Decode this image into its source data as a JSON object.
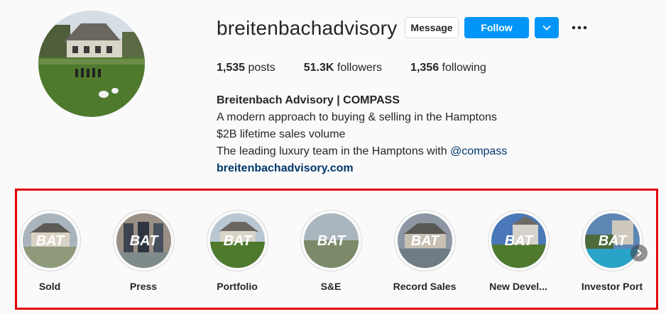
{
  "profile": {
    "username": "breitenbachadvisory",
    "avatar_icon": "profile-photo"
  },
  "actions": {
    "message_label": "Message",
    "follow_label": "Follow",
    "dropdown_icon": "chevron-down-icon",
    "more_icon": "more-options-icon"
  },
  "stats": {
    "posts_count": "1,535",
    "posts_label": "posts",
    "followers_count": "51.3K",
    "followers_label": "followers",
    "following_count": "1,356",
    "following_label": "following"
  },
  "bio": {
    "name": "Breitenbach Advisory | COMPASS",
    "line1": "A modern approach to buying & selling in the Hamptons",
    "line2": "$2B lifetime sales volume",
    "line3_prefix": "The leading luxury team in the Hamptons with ",
    "line3_mention": "@compass",
    "website": "breitenbachadvisory.com"
  },
  "highlights": {
    "cover_text": "BAT",
    "items": [
      {
        "label": "Sold"
      },
      {
        "label": "Press"
      },
      {
        "label": "Portfolio"
      },
      {
        "label": "S&E"
      },
      {
        "label": "Record Sales"
      },
      {
        "label": "New Devel..."
      },
      {
        "label": "Investor Port"
      }
    ],
    "next_icon": "chevron-right-icon"
  },
  "colors": {
    "accent": "#0095f6",
    "highlight_border": "#e40000",
    "link": "#00376b"
  }
}
